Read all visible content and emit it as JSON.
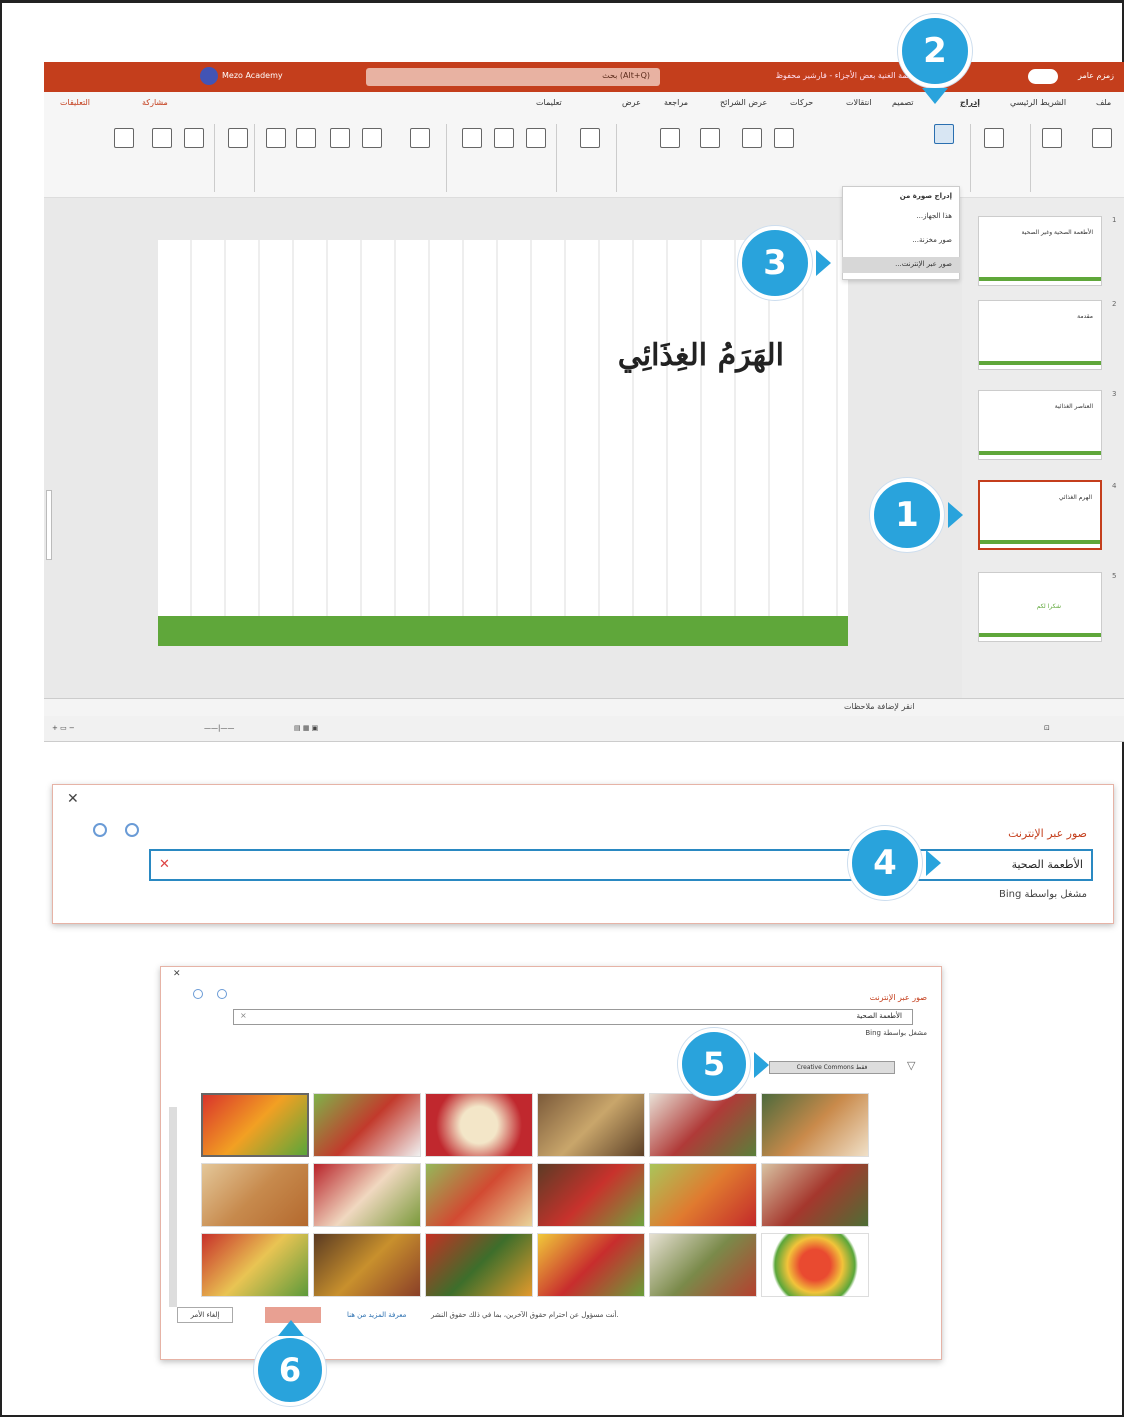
{
  "callouts": [
    "1",
    "2",
    "3",
    "4",
    "5",
    "6"
  ],
  "app": {
    "app_name": "Mezo Academy",
    "doc_title": "الأطعمة الغنية بعض الأجزاء - فارشير محفوظ",
    "search_placeholder": "بحث (Alt+Q)",
    "user_name": "زمزم عامر",
    "tabs": [
      "ملف",
      "الشريط الرئيسي",
      "إدراج",
      "تصميم",
      "انتقالات",
      "حركات",
      "عرض الشرائح",
      "مراجعة",
      "عرض",
      "تعليمات"
    ],
    "share_label": "مشاركة",
    "comments_label": "التعليقات"
  },
  "slide": {
    "title": "الهَرَمُ الغِذَائِي"
  },
  "thumbnails": [
    {
      "num": "1",
      "label": "الأطعمة الصحية وغير الصحية"
    },
    {
      "num": "2",
      "label": "مقدمة"
    },
    {
      "num": "3",
      "label": "العناصر الغذائية"
    },
    {
      "num": "4",
      "label": "الهرم الغذائي"
    },
    {
      "num": "5",
      "label": "شكرا لكم"
    }
  ],
  "dropdown": {
    "header": "إدراج صورة من",
    "items": [
      "هذا الجهاز...",
      "صور مخزنة...",
      "صور عبر الإنترنت..."
    ]
  },
  "notes_label": "انقر لإضافة ملاحظات",
  "dialog1": {
    "title": "صور عبر الإنترنت",
    "search_value": "الأطعمة الصحية",
    "powered_by": "مشغل بواسطة Bing"
  },
  "dialog2": {
    "title": "صور عبر الإنترنت",
    "search_value": "الأطعمة الصحية",
    "powered_by": "مشغل بواسطة Bing",
    "filter": "Creative Commons فقط",
    "footer_text": "أنت مسؤول عن احترام حقوق الآخرين، بما في ذلك حقوق النشر.",
    "footer_link": "معرفة المزيد من هنا",
    "cancel": "إلغاء الأمر"
  }
}
